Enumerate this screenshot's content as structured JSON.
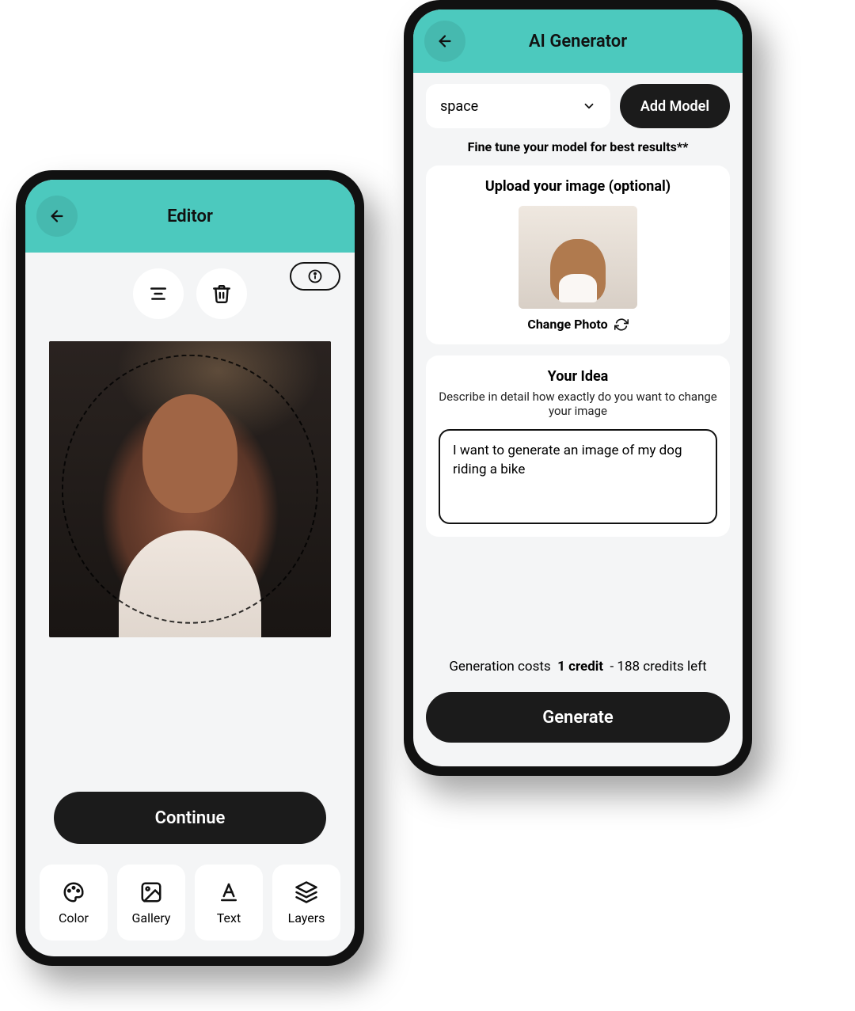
{
  "editor": {
    "title": "Editor",
    "continue_label": "Continue",
    "tools": [
      {
        "label": "Color"
      },
      {
        "label": "Gallery"
      },
      {
        "label": "Text"
      },
      {
        "label": "Layers"
      }
    ]
  },
  "generator": {
    "title": "AI Generator",
    "model_selected": "space",
    "add_model_label": "Add Model",
    "finetune_note": "Fine tune your model for best results**",
    "upload_title": "Upload your image (optional)",
    "change_photo_label": "Change Photo",
    "idea_title": "Your Idea",
    "idea_subtitle": "Describe in detail how exactly do you want to change your image",
    "idea_value": "I want to generate an image of my dog riding a bike",
    "credits_prefix": "Generation costs",
    "credits_cost": "1 credit",
    "credits_suffix": "- 188 credits left",
    "generate_label": "Generate"
  }
}
